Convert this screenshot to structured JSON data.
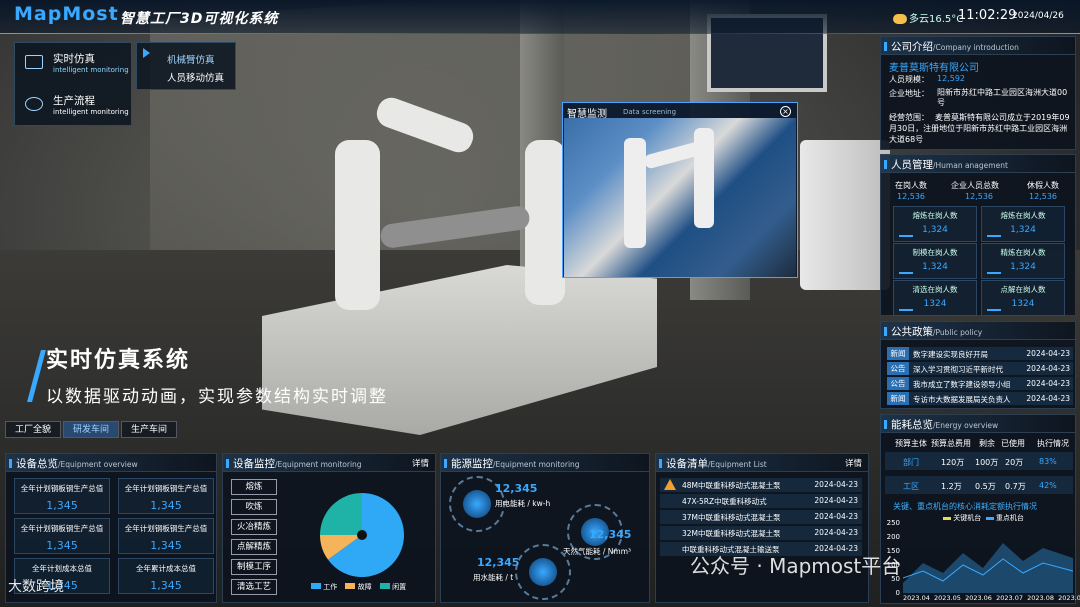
{
  "header": {
    "logo": "MapMost",
    "title": "智慧工厂3D可视化系统",
    "weather": "多云16.5°C",
    "time": "11:02:29",
    "date": "2024/04/26"
  },
  "nav": {
    "items": [
      {
        "label": "实时仿真",
        "sub": "intelligent monitoring"
      },
      {
        "label": "生产流程",
        "sub": "intelligent monitoring"
      }
    ],
    "sub_items": [
      "机械臂仿真",
      "人员移动仿真"
    ]
  },
  "banner": {
    "title": "实时仿真系统",
    "subtitle": "以数据驱动动画，实现参数结构实时调整"
  },
  "tabs": [
    "工厂全貌",
    "研发车间",
    "生产车间"
  ],
  "overlay": {
    "title": "智慧监测",
    "sub": "Data screening",
    "close": "×"
  },
  "company": {
    "title": "公司介绍",
    "sub": "/Company introduction",
    "name": "麦普莫斯特有限公司",
    "rows": [
      {
        "k": "人员规模：",
        "v": "12,592"
      },
      {
        "k": "企业地址：",
        "v": "阳新市苏红中路工业园区海洲大道00号"
      },
      {
        "k": "经营范围：",
        "v": "麦普莫斯特有限公司成立于2019年09月30日，注册地位于阳新市苏红中路工业园区海洲大道68号"
      }
    ]
  },
  "personnel": {
    "title": "人员管理",
    "sub": "/Human anagement",
    "summary": [
      {
        "label": "在岗人数",
        "value": "12,536"
      },
      {
        "label": "企业人员总数",
        "value": "12,536"
      },
      {
        "label": "休假人数",
        "value": "12,536"
      }
    ],
    "cells": [
      {
        "label": "熔炼在岗人数",
        "value": "1,324"
      },
      {
        "label": "熔炼在岗人数",
        "value": "1,324"
      },
      {
        "label": "制模在岗人数",
        "value": "1,324"
      },
      {
        "label": "精炼在岗人数",
        "value": "1,324"
      },
      {
        "label": "清选在岗人数",
        "value": "1324"
      },
      {
        "label": "点解在岗人数",
        "value": "1324"
      }
    ]
  },
  "policy": {
    "title": "公共政策",
    "sub": "/Public policy",
    "items": [
      {
        "tag": "新闻",
        "text": "数字建设实现良好开局",
        "date": "2024-04-23"
      },
      {
        "tag": "公告",
        "text": "深入学习贯彻习近平新时代",
        "date": "2024-04-23"
      },
      {
        "tag": "公告",
        "text": "我市成立了数字建设领导小组",
        "date": "2024-04-23"
      },
      {
        "tag": "新闻",
        "text": "专访市大数据发展局关负责人",
        "date": "2024-04-23"
      }
    ]
  },
  "energy_overview": {
    "title": "能耗总览",
    "sub": "/Energy overview",
    "headers": [
      "预算主体",
      "预算总费用",
      "剩余",
      "已使用",
      "执行情况"
    ],
    "rows": [
      {
        "name": "部门",
        "total": "120万",
        "left": "100万",
        "used": "20万",
        "rate": "83%"
      },
      {
        "name": "工区",
        "total": "1.2万",
        "left": "0.5万",
        "used": "0.7万",
        "rate": "42%"
      }
    ],
    "chart_title": "关键、重点机台的核心消耗定额执行情况",
    "legend": [
      "关键机台",
      "重点机台"
    ],
    "y_ticks": [
      "250",
      "200",
      "150",
      "100",
      "50",
      "0"
    ],
    "x_ticks": [
      "2023.04",
      "2023.05",
      "2023.06",
      "2023.07",
      "2023.08",
      "2023.09"
    ]
  },
  "equipment_overview": {
    "title": "设备总览",
    "sub": "/Equipment overview",
    "cells": [
      {
        "label": "全年计划钢板钢生产总值",
        "value": "1,345"
      },
      {
        "label": "全年计划钢板钢生产总值",
        "value": "1,345"
      },
      {
        "label": "全年计划钢板钢生产总值",
        "value": "1,345"
      },
      {
        "label": "全年计划钢板钢生产总值",
        "value": "1,345"
      },
      {
        "label": "全年计划成本总值",
        "value": "1,345"
      },
      {
        "label": "全年累计成本总值",
        "value": "1,345"
      }
    ]
  },
  "equipment_monitoring": {
    "title": "设备监控",
    "sub": "/Equipment monitoring",
    "more": "详情",
    "buttons": [
      "熔炼",
      "吹炼",
      "火冶精炼",
      "点解精炼",
      "制模工序",
      "清选工艺"
    ],
    "legend": [
      "工作",
      "故障",
      "闲置"
    ]
  },
  "energy_monitoring": {
    "title": "能源监控",
    "sub": "/Equipment monitoring",
    "items": [
      {
        "value": "12,345",
        "label": "用电能耗 / kw-h"
      },
      {
        "value": "12,345",
        "label": "天然气能耗 / Nmm³"
      },
      {
        "value": "12,345",
        "label": "用水能耗 / t"
      }
    ]
  },
  "equipment_list": {
    "title": "设备清单",
    "sub": "/Equipment List",
    "more": "详情",
    "rows": [
      {
        "text": "48M中联重科移动式混凝土泵",
        "date": "2024-04-23",
        "warn": true
      },
      {
        "text": "47X-5RZ中联重科移动式",
        "date": "2024-04-23",
        "warn": false
      },
      {
        "text": "37M中联重科移动式混凝土泵",
        "date": "2024-04-23",
        "warn": false
      },
      {
        "text": "32M中联重科移动式混凝土泵",
        "date": "2024-04-23",
        "warn": false
      },
      {
        "text": "中联重科移动式混凝土输送泵",
        "date": "2024-04-23",
        "warn": false
      }
    ]
  },
  "watermark": {
    "text": "公众号 · Mapmost平台",
    "brand": "大数跨境"
  },
  "chart_data": {
    "type": "pie",
    "categories": [
      "工作",
      "故障",
      "闲置"
    ],
    "values": [
      65,
      10,
      25
    ],
    "colors": [
      "#2fa8f5",
      "#f5b35a",
      "#1fb3a8"
    ]
  }
}
